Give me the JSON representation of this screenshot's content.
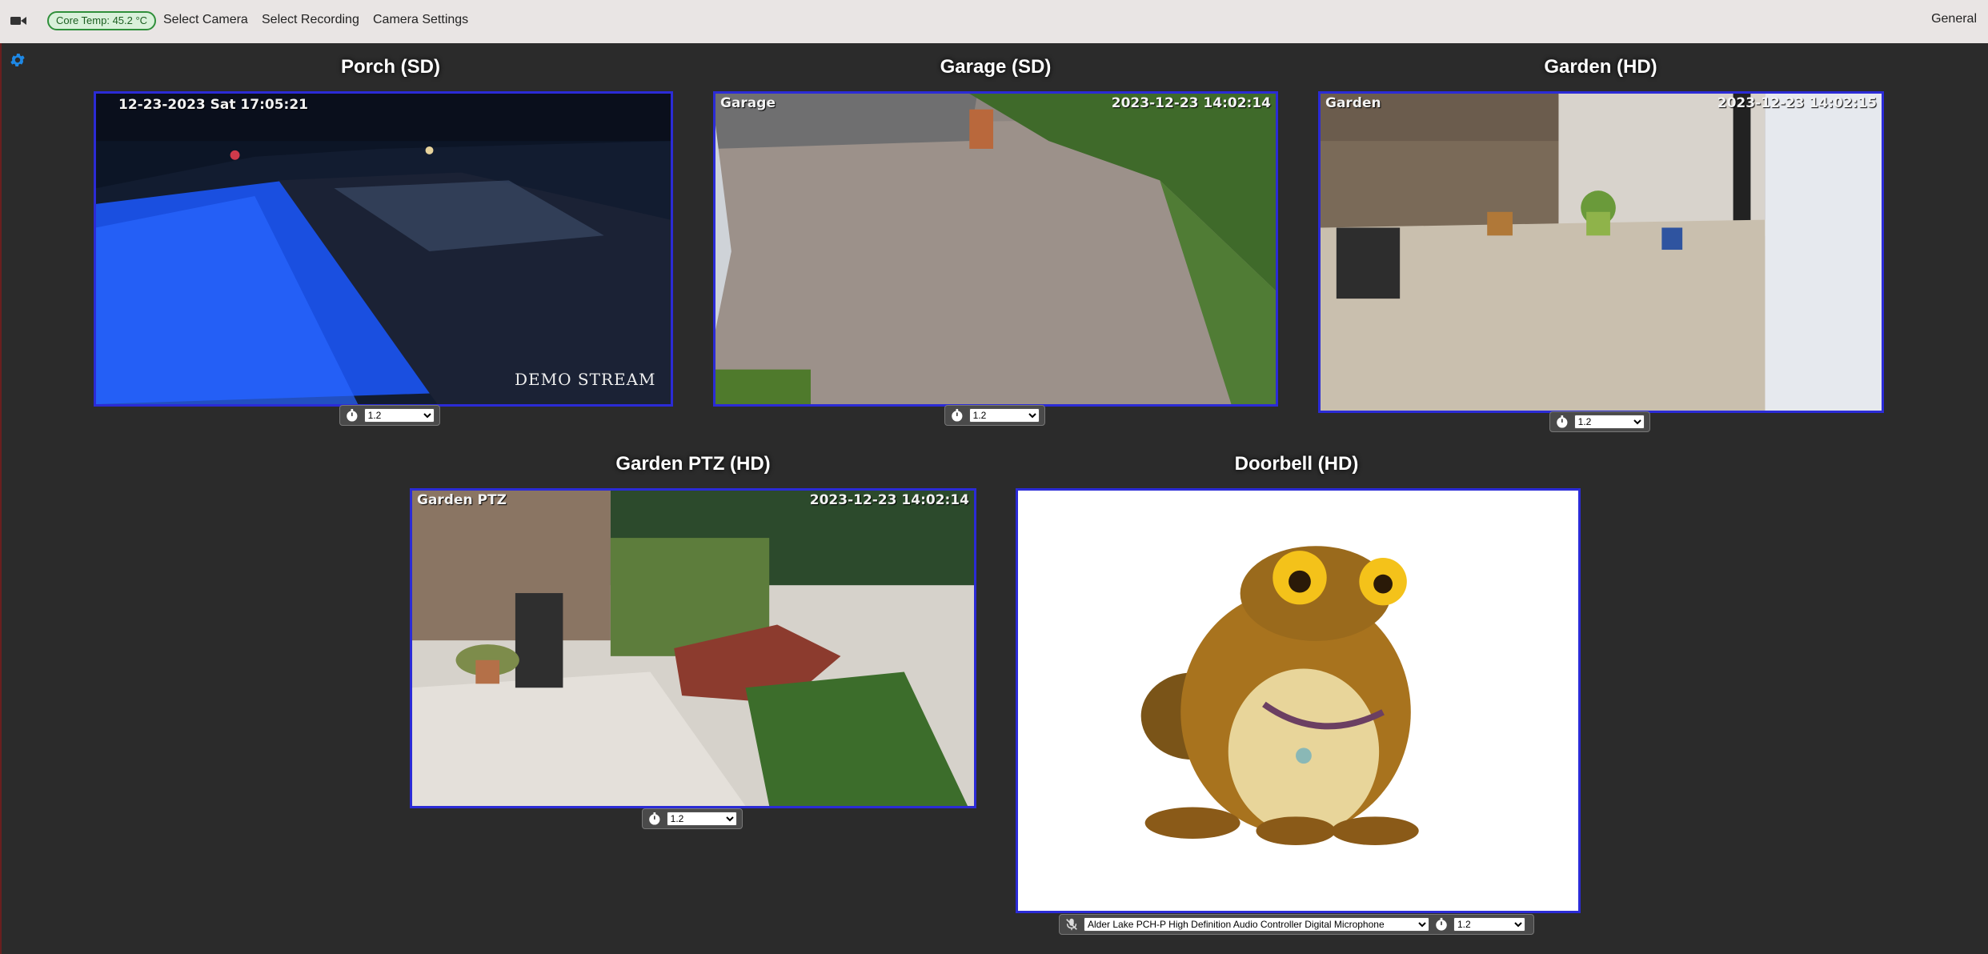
{
  "topbar": {
    "core_temp": "Core Temp: 45.2 °C",
    "menu": [
      "Select Camera",
      "Select Recording",
      "Camera Settings"
    ],
    "right_label": "General"
  },
  "cameras": [
    {
      "title": "Porch (SD)",
      "overlay_left": "12-23-2023 Sat 17:05:21",
      "overlay_right": "",
      "demo_text": "DEMO STREAM",
      "refresh": "1.2"
    },
    {
      "title": "Garage (SD)",
      "overlay_left": "Garage",
      "overlay_right": "2023-12-23 14:02:14",
      "refresh": "1.2"
    },
    {
      "title": "Garden (HD)",
      "overlay_left": "Garden",
      "overlay_right": "2023-12-23 14:02:15",
      "refresh": "1.2"
    },
    {
      "title": "Garden PTZ (HD)",
      "overlay_left": "Garden PTZ",
      "overlay_right": "2023-12-23 14:02:14",
      "refresh": "1.2"
    },
    {
      "title": "Doorbell (HD)",
      "overlay_left": "",
      "overlay_right": "",
      "refresh": "1.2",
      "audio_device": "Alder Lake PCH-P High Definition Audio Controller Digital Microphone"
    }
  ],
  "icons": {
    "topbar_camera": "video-camera-icon",
    "settings": "gear-icon",
    "timer": "stopwatch-icon",
    "mic": "microphone-muted-icon"
  },
  "colors": {
    "feed_border": "#2b2bd6",
    "gear": "#1e88e5",
    "temp_badge": "#2f8f3a"
  }
}
